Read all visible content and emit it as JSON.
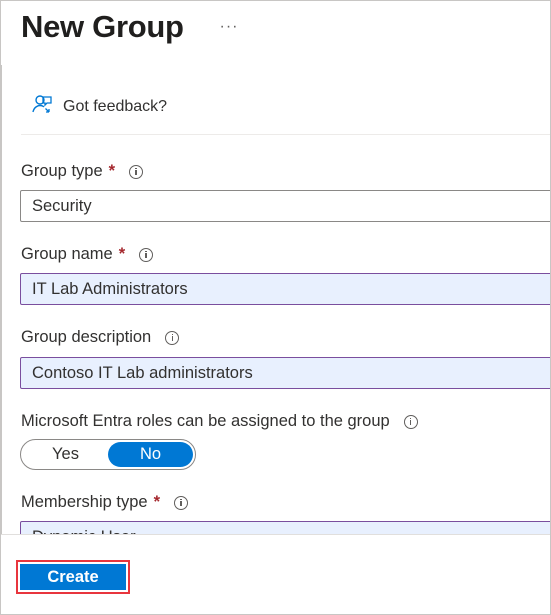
{
  "page": {
    "title": "New Group",
    "more_icon": "ellipsis-icon",
    "more_label": "···"
  },
  "feedback": {
    "icon": "feedback-person-icon",
    "label": "Got feedback?"
  },
  "form": {
    "group_type": {
      "label": "Group type",
      "required_marker": "*",
      "value": "Security"
    },
    "group_name": {
      "label": "Group name",
      "required_marker": "*",
      "value": "IT Lab Administrators"
    },
    "group_description": {
      "label": "Group description",
      "value": "Contoso IT Lab administrators"
    },
    "entra_roles": {
      "label": "Microsoft Entra roles can be assigned to the group",
      "options": [
        "Yes",
        "No"
      ],
      "selected": "No"
    },
    "membership_type": {
      "label": "Membership type",
      "required_marker": "*",
      "value": "Dynamic User"
    }
  },
  "footer": {
    "create_label": "Create"
  },
  "colors": {
    "accent": "#0078d4",
    "required": "#a4262c",
    "highlight_outline": "#e8353d",
    "filled_field_bg": "#e8f0fe"
  }
}
